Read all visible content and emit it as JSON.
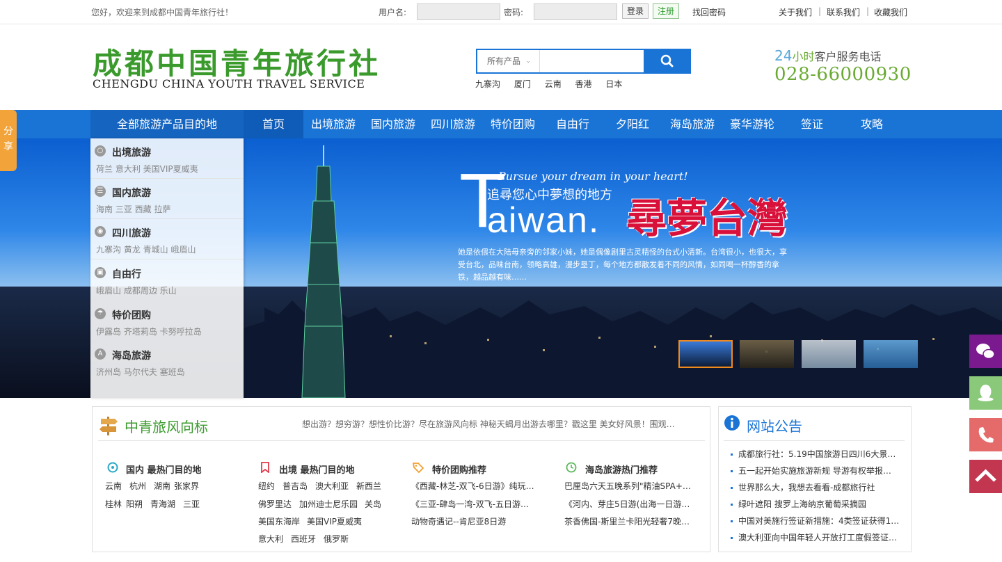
{
  "topbar": {
    "welcome": "您好，欢迎来到成都中国青年旅行社！",
    "username_label": "用户名:",
    "password_label": "密码:",
    "login": "登录",
    "register": "注册",
    "forgot": "找回密码",
    "links": [
      "关于我们",
      "联系我们",
      "收藏我们"
    ]
  },
  "logo": {
    "cn": "成都中国青年旅行社",
    "en": "CHENGDU CHINA YOUTH TRAVEL SERVICE"
  },
  "search": {
    "category": "所有产品",
    "hotwords": [
      "九寨沟",
      "厦门",
      "云南",
      "香港",
      "日本"
    ]
  },
  "hotline": {
    "prefix": "24",
    "unit": "小时",
    "label": "客户服务电话",
    "number": "028-66000930"
  },
  "nav": {
    "all_label": "全部旅游产品目的地",
    "items": [
      "首页",
      "出境旅游",
      "国内旅游",
      "四川旅游",
      "特价团购",
      "自由行",
      "夕阳红",
      "海岛旅游",
      "豪华游轮",
      "签证",
      "攻略"
    ]
  },
  "share": "分享",
  "side_menu": [
    {
      "title": "出境旅游",
      "subs": "荷兰 意大利 美国VIP夏威夷"
    },
    {
      "title": "国内旅游",
      "subs": "海南 三亚 西藏 拉萨"
    },
    {
      "title": "四川旅游",
      "subs": "九寨沟 黄龙 青城山 峨眉山"
    },
    {
      "title": "自由行",
      "subs": "峨眉山 成都周边 乐山"
    },
    {
      "title": "特价团购",
      "subs": "伊露岛 齐塔莉岛 卡努呼拉岛"
    },
    {
      "title": "海岛旅游",
      "subs": "济州岛 马尔代夫 塞班岛"
    }
  ],
  "banner": {
    "script": "Pursue your dream in your heart!",
    "subtitle": "追尋您心中夢想的地方",
    "big_T": "T",
    "big_rest": "aiwan.",
    "red_title": "尋夢台灣",
    "desc": "她是依偎在大陆母亲旁的邻家小妹，她是偶像剧里古灵精怪的台式小清新。台湾很小，也很大，享受台北，品味台南，领略高雄，漫步垦丁，每个地方都散发着不同的风情，如同喝一杯醇香的拿铁，越品越有味……"
  },
  "vane": {
    "title": "中青旅风向标",
    "text": "想出游？想穷游？想性价比游？尽在旅游风向标 神秘天蝎月出游去哪里？戳这里 美女好风景！围观…",
    "columns": [
      {
        "title": "国内 最热门目的地",
        "rows": [
          [
            "云南",
            "杭州",
            "湖南",
            "张家界"
          ],
          [
            "桂林",
            "阳朔",
            "青海湖",
            "三亚"
          ]
        ]
      },
      {
        "title": "出境 最热门目的地",
        "rows": [
          [
            "纽约",
            "普吉岛",
            "澳大利亚",
            "新西兰"
          ],
          [
            "佛罗里达",
            "加州迪士尼乐园",
            "关岛"
          ],
          [
            "美国东海岸",
            "美国VIP夏威夷"
          ],
          [
            "意大利",
            "西班牙",
            "俄罗斯"
          ]
        ]
      },
      {
        "title": "特价团购推荐",
        "rows": [
          [
            "《西藏-林芝-双飞-6日游》纯玩…"
          ],
          [
            "《三亚-肆岛一湾-双飞-五日游…"
          ],
          [
            "动物奇遇记--肯尼亚8日游"
          ]
        ]
      },
      {
        "title": "海岛旅游热门推荐",
        "rows": [
          [
            "巴厘岛六天五晚系列\"精油SPA+…"
          ],
          [
            "《河内、芽庄5日游(出海一日游…"
          ],
          [
            "茶香佛国-斯里兰卡阳光轻奢7晚…"
          ]
        ]
      }
    ]
  },
  "notice": {
    "title": "网站公告",
    "items": [
      "成都旅行社：5.19中国旅游日四川6大景…",
      "五一起开始实施旅游新规 导游有权举报…",
      "世界那么大，我想去看看-成都旅行社",
      "绿叶遮阳 搜罗上海纳京葡萄采摘园",
      "中国对美施行签证新措施：4类签证获得1…",
      "澳大利亚向中国年轻人开放打工度假签证…"
    ]
  },
  "colors": {
    "brand_blue": "#1a74d6",
    "logo_green": "#3a9a2c",
    "accent_red": "#d8103a"
  }
}
